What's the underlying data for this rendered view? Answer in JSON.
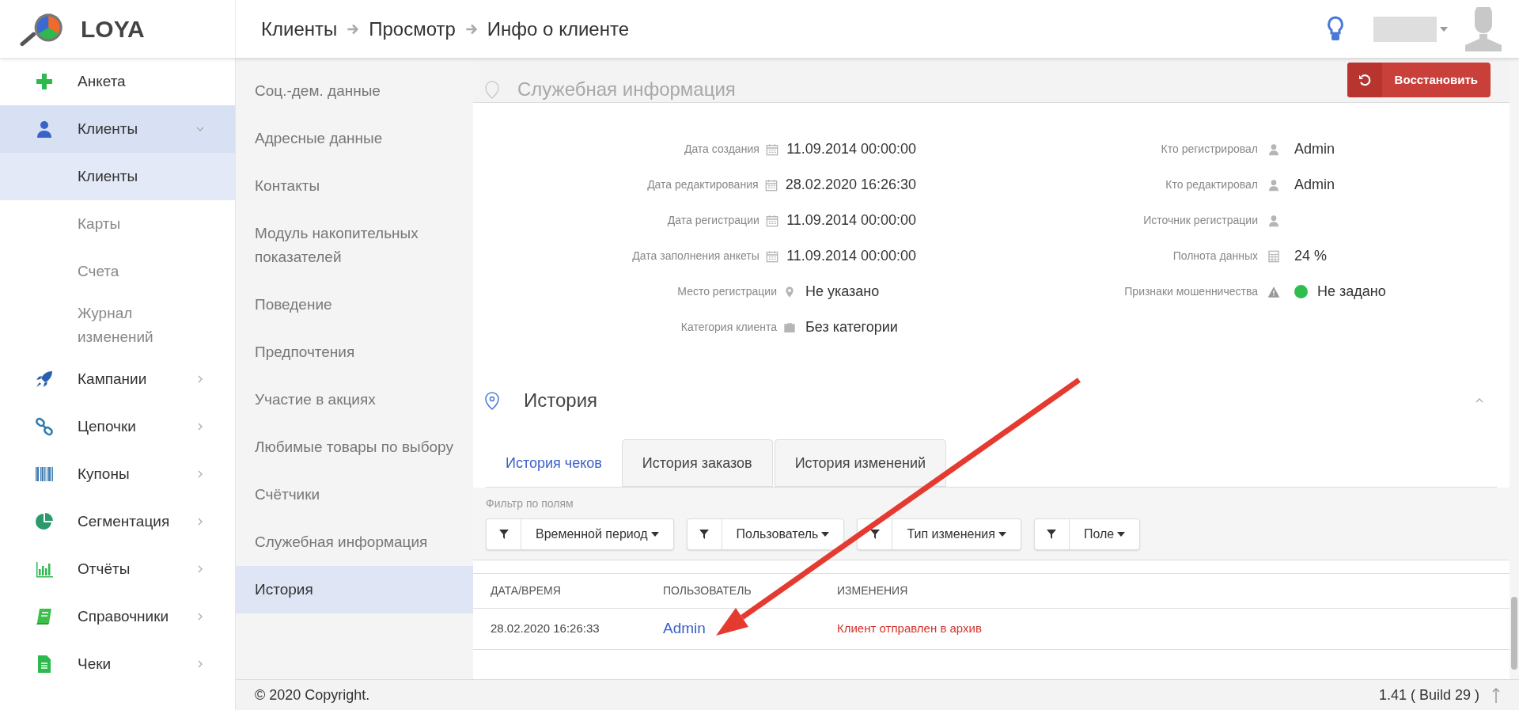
{
  "app": {
    "logo_text": "LOYA"
  },
  "breadcrumbs": [
    "Клиенты",
    "Просмотр",
    "Инфо о клиенте"
  ],
  "sidebar": {
    "items": [
      {
        "label": "Анкета",
        "selected": false
      },
      {
        "label": "Клиенты",
        "selected": true,
        "expanded": true,
        "children": [
          {
            "label": "Клиенты",
            "selected": true
          },
          {
            "label": "Карты",
            "selected": false
          },
          {
            "label": "Счета",
            "selected": false
          },
          {
            "label": "Журнал изменений",
            "selected": false
          }
        ]
      },
      {
        "label": "Кампании",
        "selected": false,
        "expanded": false
      },
      {
        "label": "Цепочки",
        "selected": false,
        "expanded": false
      },
      {
        "label": "Купоны",
        "selected": false,
        "expanded": false
      },
      {
        "label": "Сегментация",
        "selected": false,
        "expanded": false
      },
      {
        "label": "Отчёты",
        "selected": false,
        "expanded": false
      },
      {
        "label": "Справочники",
        "selected": false,
        "expanded": false
      },
      {
        "label": "Чеки",
        "selected": false,
        "expanded": false
      }
    ]
  },
  "section_nav": [
    {
      "label": "Соц.-дем. данные",
      "selected": false
    },
    {
      "label": "Адресные данные",
      "selected": false
    },
    {
      "label": "Контакты",
      "selected": false
    },
    {
      "label": "Модуль накопительных показателей",
      "selected": false
    },
    {
      "label": "Поведение",
      "selected": false
    },
    {
      "label": "Предпочтения",
      "selected": false
    },
    {
      "label": "Участие в акциях",
      "selected": false
    },
    {
      "label": "Любимые товары по выбору",
      "selected": false
    },
    {
      "label": "Счётчики",
      "selected": false
    },
    {
      "label": "Служебная информация",
      "selected": false
    },
    {
      "label": "История",
      "selected": true
    }
  ],
  "service_header": {
    "title": "Служебная информация",
    "restore_button": "Восстановить"
  },
  "service_info": {
    "left": [
      {
        "label": "Дата создания",
        "kind": "date",
        "value": "11.09.2014 00:00:00"
      },
      {
        "label": "Дата редактирования",
        "kind": "date",
        "value": "28.02.2020 16:26:30"
      },
      {
        "label": "Дата регистрации",
        "kind": "date",
        "value": "11.09.2014 00:00:00"
      },
      {
        "label": "Дата заполнения анкеты",
        "kind": "date",
        "value": "11.09.2014 00:00:00"
      },
      {
        "label": "Место регистрации",
        "kind": "place",
        "value": "Не указано"
      },
      {
        "label": "Категория клиента",
        "kind": "category",
        "value": "Без категории"
      }
    ],
    "right": [
      {
        "label": "Кто регистрировал",
        "kind": "person",
        "value": "Admin"
      },
      {
        "label": "Кто редактировал",
        "kind": "person",
        "value": "Admin"
      },
      {
        "label": "Источник регистрации",
        "kind": "person"
      },
      {
        "label": "Полнота данных",
        "kind": "calculator",
        "value": "24 %"
      },
      {
        "label": "Признаки мошенничества",
        "kind": "warning",
        "value": "Не задано",
        "color": "#2ebd4e"
      }
    ]
  },
  "history": {
    "title": "История",
    "expanded": true,
    "tabs": [
      {
        "label": "История чеков",
        "selected": true
      },
      {
        "label": "История заказов",
        "selected": false
      },
      {
        "label": "История изменений",
        "selected": false
      }
    ],
    "filter_label": "Фильтр по полям",
    "filters": [
      "Временной период",
      "Пользователь",
      "Тип изменения",
      "Поле"
    ],
    "table": {
      "columns": [
        "ДАТА/ВРЕМЯ",
        "ПОЛЬЗОВАТЕЛЬ",
        "ИЗМЕНЕНИЯ"
      ],
      "rows": [
        {
          "date": "28.02.2020 16:26:33",
          "user": "Admin",
          "change": "Клиент отправлен в архив"
        }
      ]
    }
  },
  "footer": {
    "copyright": "© 2020 Copyright.",
    "version": "1.41 ( Build 29 )"
  }
}
